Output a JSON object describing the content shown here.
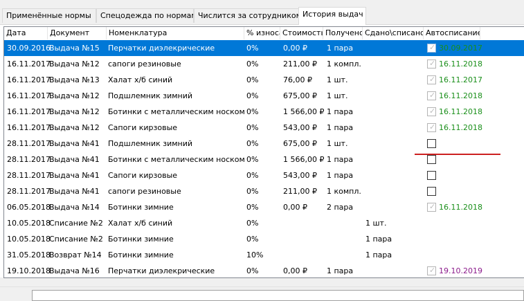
{
  "tabs": [
    {
      "label": "Применённые нормы"
    },
    {
      "label": "Спецодежда по нормам"
    },
    {
      "label": "Числится за сотрудником"
    },
    {
      "label": "История выдач"
    }
  ],
  "grid": {
    "columns": [
      "Дата",
      "Документ",
      "Номенклатура",
      "% износа",
      "Стоимость",
      "Получено",
      "Сдано\\списано",
      "Автосписание"
    ],
    "rows": [
      {
        "date": "30.09.2016",
        "doc": "Выдача №15",
        "item": "Перчатки диэлекрические",
        "wear": "0%",
        "cost": "0,00 ₽",
        "received": "1 пара",
        "returned": "",
        "auto": true,
        "auto_date": "30.09.2017",
        "auto_color": "#1a8f1a",
        "selected": true
      },
      {
        "date": "16.11.2017",
        "doc": "Выдача №12",
        "item": "сапоги резиновые",
        "wear": "0%",
        "cost": "211,00 ₽",
        "received": "1 компл.",
        "returned": "",
        "auto": true,
        "auto_date": "16.11.2018",
        "auto_color": "#1a8f1a"
      },
      {
        "date": "16.11.2017",
        "doc": "Выдача №13",
        "item": "Халат х/б синий",
        "wear": "0%",
        "cost": "76,00 ₽",
        "received": "1 шт.",
        "returned": "",
        "auto": true,
        "auto_date": "16.11.2017",
        "auto_color": "#1a8f1a"
      },
      {
        "date": "16.11.2017",
        "doc": "Выдача №12",
        "item": "Подшлемник зимний",
        "wear": "0%",
        "cost": "675,00 ₽",
        "received": "1 шт.",
        "returned": "",
        "auto": true,
        "auto_date": "16.11.2018",
        "auto_color": "#1a8f1a"
      },
      {
        "date": "16.11.2017",
        "doc": "Выдача №12",
        "item": "Ботинки с металлическим носком",
        "wear": "0%",
        "cost": "1 566,00 ₽",
        "received": "1 пара",
        "returned": "",
        "auto": true,
        "auto_date": "16.11.2018",
        "auto_color": "#1a8f1a"
      },
      {
        "date": "16.11.2017",
        "doc": "Выдача №12",
        "item": "Сапоги кирзовые",
        "wear": "0%",
        "cost": "543,00 ₽",
        "received": "1 пара",
        "returned": "",
        "auto": true,
        "auto_date": "16.11.2018",
        "auto_color": "#1a8f1a"
      },
      {
        "date": "28.11.2017",
        "doc": "Выдача №41",
        "item": "Подшлемник зимний",
        "wear": "0%",
        "cost": "675,00 ₽",
        "received": "1 шт.",
        "returned": "",
        "auto": false,
        "auto_date": "",
        "auto_color": ""
      },
      {
        "date": "28.11.2017",
        "doc": "Выдача №41",
        "item": "Ботинки с металлическим носком",
        "wear": "0%",
        "cost": "1 566,00 ₽",
        "received": "1 пара",
        "returned": "",
        "auto": false,
        "auto_date": "",
        "auto_color": ""
      },
      {
        "date": "28.11.2017",
        "doc": "Выдача №41",
        "item": "Сапоги кирзовые",
        "wear": "0%",
        "cost": "543,00 ₽",
        "received": "1 пара",
        "returned": "",
        "auto": false,
        "auto_date": "",
        "auto_color": ""
      },
      {
        "date": "28.11.2017",
        "doc": "Выдача №41",
        "item": "сапоги резиновые",
        "wear": "0%",
        "cost": "211,00 ₽",
        "received": "1 компл.",
        "returned": "",
        "auto": false,
        "auto_date": "",
        "auto_color": ""
      },
      {
        "date": "06.05.2018",
        "doc": "Выдача №14",
        "item": "Ботинки зимние",
        "wear": "0%",
        "cost": "0,00 ₽",
        "received": "2 пара",
        "returned": "",
        "auto": true,
        "auto_date": "16.11.2018",
        "auto_color": "#1a8f1a"
      },
      {
        "date": "10.05.2018",
        "doc": "Списание №2",
        "item": "Халат х/б синий",
        "wear": "0%",
        "cost": "",
        "received": "",
        "returned": "1 шт.",
        "auto": null,
        "auto_date": "",
        "auto_color": ""
      },
      {
        "date": "10.05.2018",
        "doc": "Списание №2",
        "item": "Ботинки зимние",
        "wear": "0%",
        "cost": "",
        "received": "",
        "returned": "1 пара",
        "auto": null,
        "auto_date": "",
        "auto_color": ""
      },
      {
        "date": "31.05.2018",
        "doc": "Возврат №14",
        "item": "Ботинки зимние",
        "wear": "10%",
        "cost": "",
        "received": "",
        "returned": "1 пара",
        "auto": null,
        "auto_date": "",
        "auto_color": ""
      },
      {
        "date": "19.10.2018",
        "doc": "Выдача №16",
        "item": "Перчатки диэлекрические",
        "wear": "0%",
        "cost": "0,00 ₽",
        "received": "1 пара",
        "returned": "",
        "auto": true,
        "auto_date": "19.10.2019",
        "auto_color": "#8b1a8b"
      }
    ]
  },
  "colors": {
    "selection": "#0078d7",
    "annotation_line": "#cc2020"
  },
  "icons": {
    "checkbox": "checkbox-icon",
    "checkmark": "✓"
  }
}
